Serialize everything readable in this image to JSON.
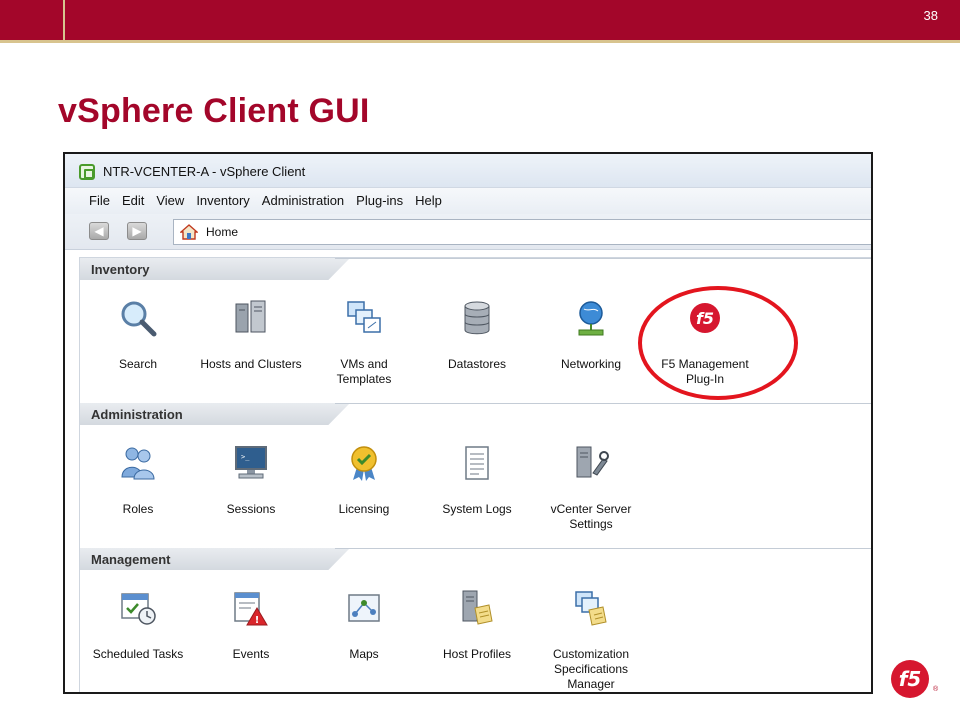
{
  "slide": {
    "number": "38",
    "title": "vSphere Client GUI"
  },
  "window": {
    "title": "NTR-VCENTER-A - vSphere Client"
  },
  "menubar": [
    "File",
    "Edit",
    "View",
    "Inventory",
    "Administration",
    "Plug-ins",
    "Help"
  ],
  "toolbar": {
    "back_icon": "back-arrow-icon",
    "forward_icon": "forward-arrow-icon",
    "address": "Home"
  },
  "sections": [
    {
      "label": "Inventory",
      "items": [
        {
          "label": "Search",
          "icon": "search-icon"
        },
        {
          "label": "Hosts and Clusters",
          "icon": "hosts-clusters-icon"
        },
        {
          "label": "VMs and\nTemplates",
          "icon": "vms-templates-icon"
        },
        {
          "label": "Datastores",
          "icon": "datastore-icon"
        },
        {
          "label": "Networking",
          "icon": "networking-icon"
        },
        {
          "label": "F5 Management\nPlug-In",
          "icon": "f5-logo-icon"
        }
      ]
    },
    {
      "label": "Administration",
      "items": [
        {
          "label": "Roles",
          "icon": "roles-icon"
        },
        {
          "label": "Sessions",
          "icon": "sessions-icon"
        },
        {
          "label": "Licensing",
          "icon": "licensing-icon"
        },
        {
          "label": "System Logs",
          "icon": "system-logs-icon"
        },
        {
          "label": "vCenter Server\nSettings",
          "icon": "server-settings-icon"
        }
      ]
    },
    {
      "label": "Management",
      "items": [
        {
          "label": "Scheduled Tasks",
          "icon": "scheduled-tasks-icon"
        },
        {
          "label": "Events",
          "icon": "events-icon"
        },
        {
          "label": "Maps",
          "icon": "maps-icon"
        },
        {
          "label": "Host Profiles",
          "icon": "host-profiles-icon"
        },
        {
          "label": "Customization\nSpecifications\nManager",
          "icon": "customization-icon"
        }
      ]
    }
  ],
  "colors": {
    "brand": "#a3062a",
    "accent_gold": "#d8c48f",
    "highlight": "#e3151e"
  }
}
